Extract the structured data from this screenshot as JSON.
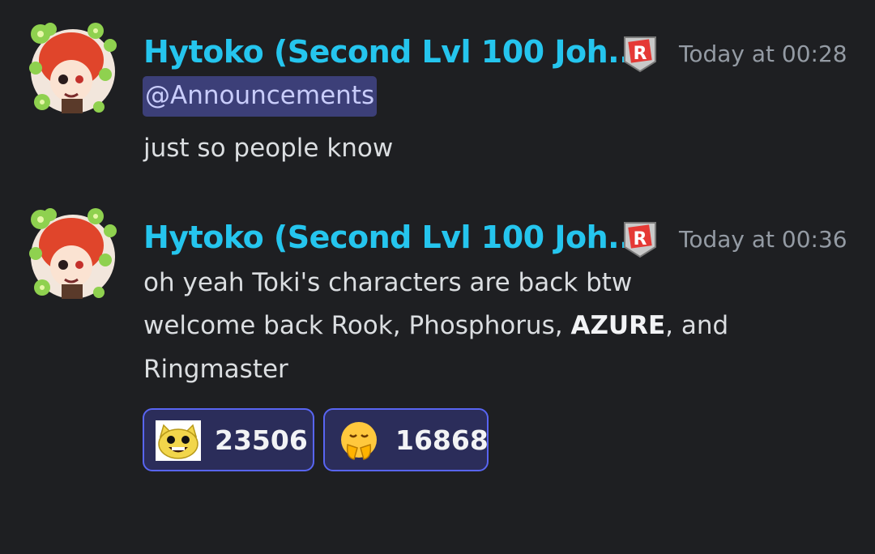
{
  "messages": [
    {
      "author": "Hytoko (Second Lvl 100 Joh...",
      "timestamp": "Today at 00:28",
      "role_icon": "roblox-icon",
      "mention": "@Announcements",
      "lines": [
        "just so people know"
      ]
    },
    {
      "author": "Hytoko (Second Lvl 100 Joh...",
      "timestamp": "Today at 00:36",
      "role_icon": "roblox-icon",
      "lines": [
        "oh yeah Toki's characters are back btw",
        "welcome back Rook, Phosphorus, ",
        "AZURE",
        ", and",
        "Ringmaster"
      ],
      "reactions": [
        {
          "emoji": "grinning-cat-emoji",
          "count": "23506"
        },
        {
          "emoji": "pleading-hands-emoji",
          "count": "16868"
        }
      ]
    }
  ],
  "colors": {
    "background": "#1e1f22",
    "username": "#25c5ee",
    "mention_bg": "#3c3f78",
    "reaction_border": "#5865f2"
  }
}
